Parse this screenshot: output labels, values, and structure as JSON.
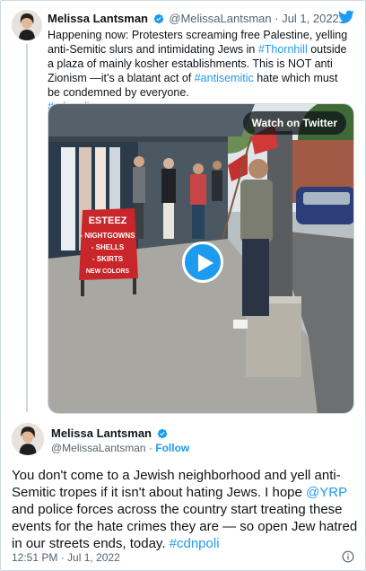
{
  "quoted_tweet": {
    "name": "Melissa Lantsman",
    "handle": "@MelissaLantsman",
    "date": "Jul 1, 2022",
    "text_part1": "Happening now: Protesters screaming free Palestine, yelling anti-Semitic slurs and intimidating Jews in ",
    "hashtag_thornhill": "#Thornhill",
    "text_part2": " outside a plaza of mainly kosher establishments. This is NOT anti Zionism —it’s a blatant act of ",
    "hashtag_antisemitic": "#antisemitic",
    "text_part3": " hate which must be condemned by everyone.",
    "hashtag_cdnpoli": "#cdnpoli",
    "video": {
      "watch_label": "Watch on Twitter",
      "store_sign": {
        "title": "ESTEEZ",
        "line1": "- NIGHTGOWNS",
        "line2": "- SHELLS",
        "line3": "- SKIRTS",
        "line4": "NEW COLORS"
      }
    }
  },
  "main_tweet": {
    "name": "Melissa Lantsman",
    "handle": "@MelissaLantsman",
    "follow_label": "Follow",
    "text_part1": "You don't come to a Jewish neighborhood and yell anti-Semitic tropes if it isn't about hating Jews. I hope ",
    "mention_yrp": "@YRP",
    "text_part2": " and police forces across the country start treating these events for the hate crimes they are — so open Jew hatred in our streets ends, today. ",
    "hashtag_cdnpoli": "#cdnpoli",
    "timestamp": "12:51 PM · Jul 1, 2022"
  },
  "colors": {
    "accent": "#1d9bf0",
    "text": "#0f1419",
    "muted": "#536471",
    "border": "#cfd9de"
  },
  "icons": [
    "twitter-bird-icon",
    "verified-badge-icon",
    "play-icon",
    "info-icon"
  ]
}
